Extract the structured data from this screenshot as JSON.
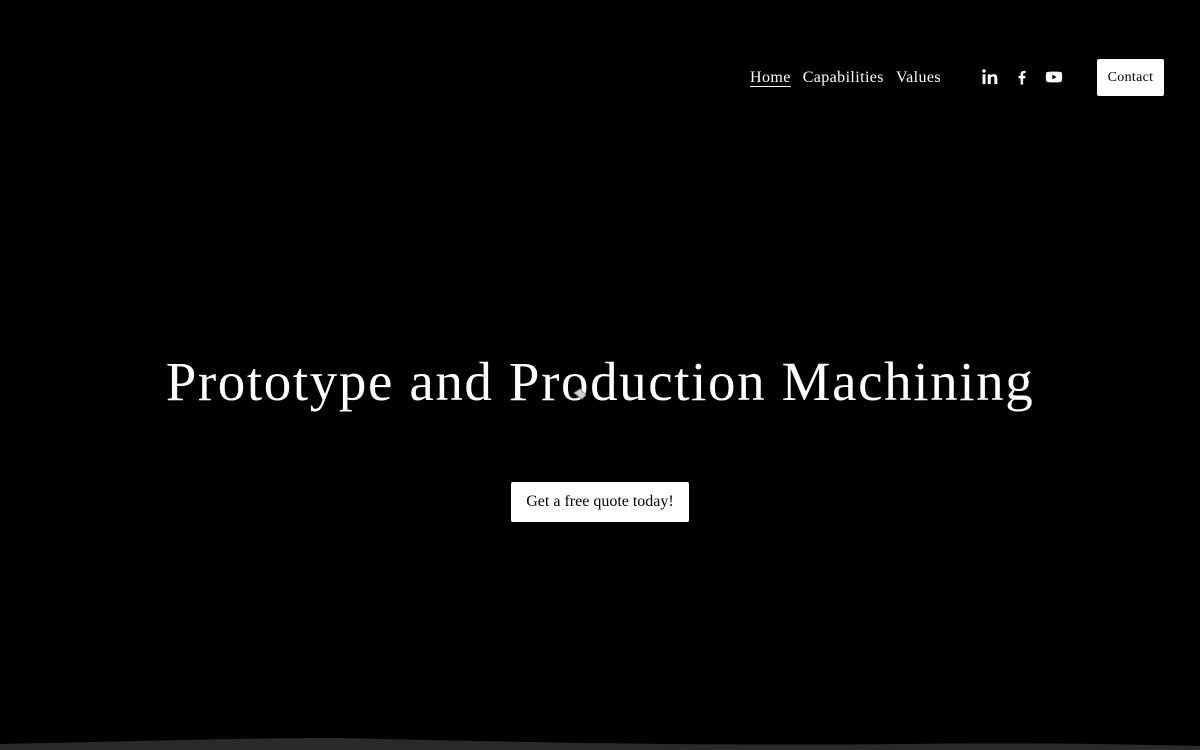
{
  "nav": {
    "items": [
      {
        "label": "Home",
        "active": true
      },
      {
        "label": "Capabilities",
        "active": false
      },
      {
        "label": "Values",
        "active": false
      }
    ]
  },
  "social": {
    "icons": [
      "linkedin-icon",
      "facebook-icon",
      "youtube-icon"
    ]
  },
  "header": {
    "contact_label": "Contact"
  },
  "hero": {
    "title": "Prototype and Production Machining",
    "cta_label": "Get a free quote today!"
  },
  "colors": {
    "background": "#000000",
    "text": "#ffffff",
    "button_bg": "#ffffff",
    "button_text": "#000000",
    "wave": "#2a2a2a"
  }
}
